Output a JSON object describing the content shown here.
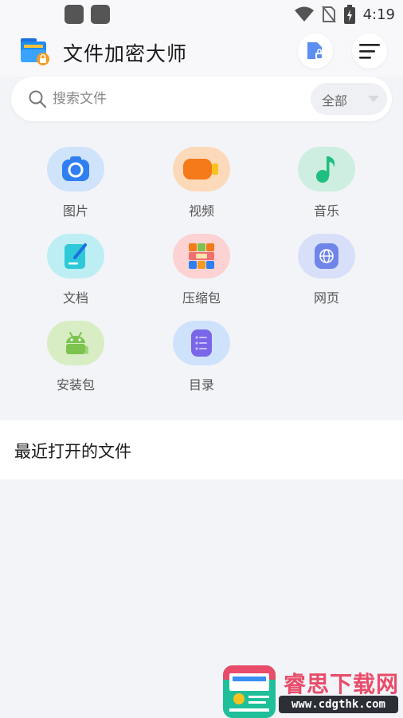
{
  "status_bar": {
    "time": "4:19",
    "icons": [
      "wifi-icon",
      "no-sim-icon",
      "battery-charging-icon"
    ]
  },
  "header": {
    "app_title": "文件加密大师",
    "logo_icon": "folder-lock-icon",
    "actions": [
      {
        "name": "encrypted-file-button",
        "icon": "file-lock-icon"
      },
      {
        "name": "menu-button",
        "icon": "menu-icon"
      }
    ]
  },
  "search": {
    "placeholder": "搜索文件",
    "filter_value": "全部"
  },
  "categories": [
    {
      "label": "图片",
      "icon": "camera-icon",
      "bg": "#cfe3fb",
      "fg": "#2f7ff2"
    },
    {
      "label": "视频",
      "icon": "video-icon",
      "bg": "#fcd9b8",
      "fg": "#f47a1a"
    },
    {
      "label": "音乐",
      "icon": "music-note-icon",
      "bg": "#cdeee0",
      "fg": "#1fbf80"
    },
    {
      "label": "文档",
      "icon": "document-icon",
      "bg": "#bdeef3",
      "fg": "#2ec9d8"
    },
    {
      "label": "压缩包",
      "icon": "archive-icon",
      "bg": "#fcd2d2",
      "fg": "#f07070"
    },
    {
      "label": "网页",
      "icon": "globe-icon",
      "bg": "#d8dff8",
      "fg": "#6f86e8"
    },
    {
      "label": "安装包",
      "icon": "android-icon",
      "bg": "#d8edc4",
      "fg": "#7cc44f"
    },
    {
      "label": "目录",
      "icon": "list-icon",
      "bg": "#cfe2fb",
      "fg": "#7a66e8"
    }
  ],
  "recent": {
    "title": "最近打开的文件"
  },
  "watermark": {
    "title": "睿思下载网",
    "url": "www.cdgthk.com"
  }
}
